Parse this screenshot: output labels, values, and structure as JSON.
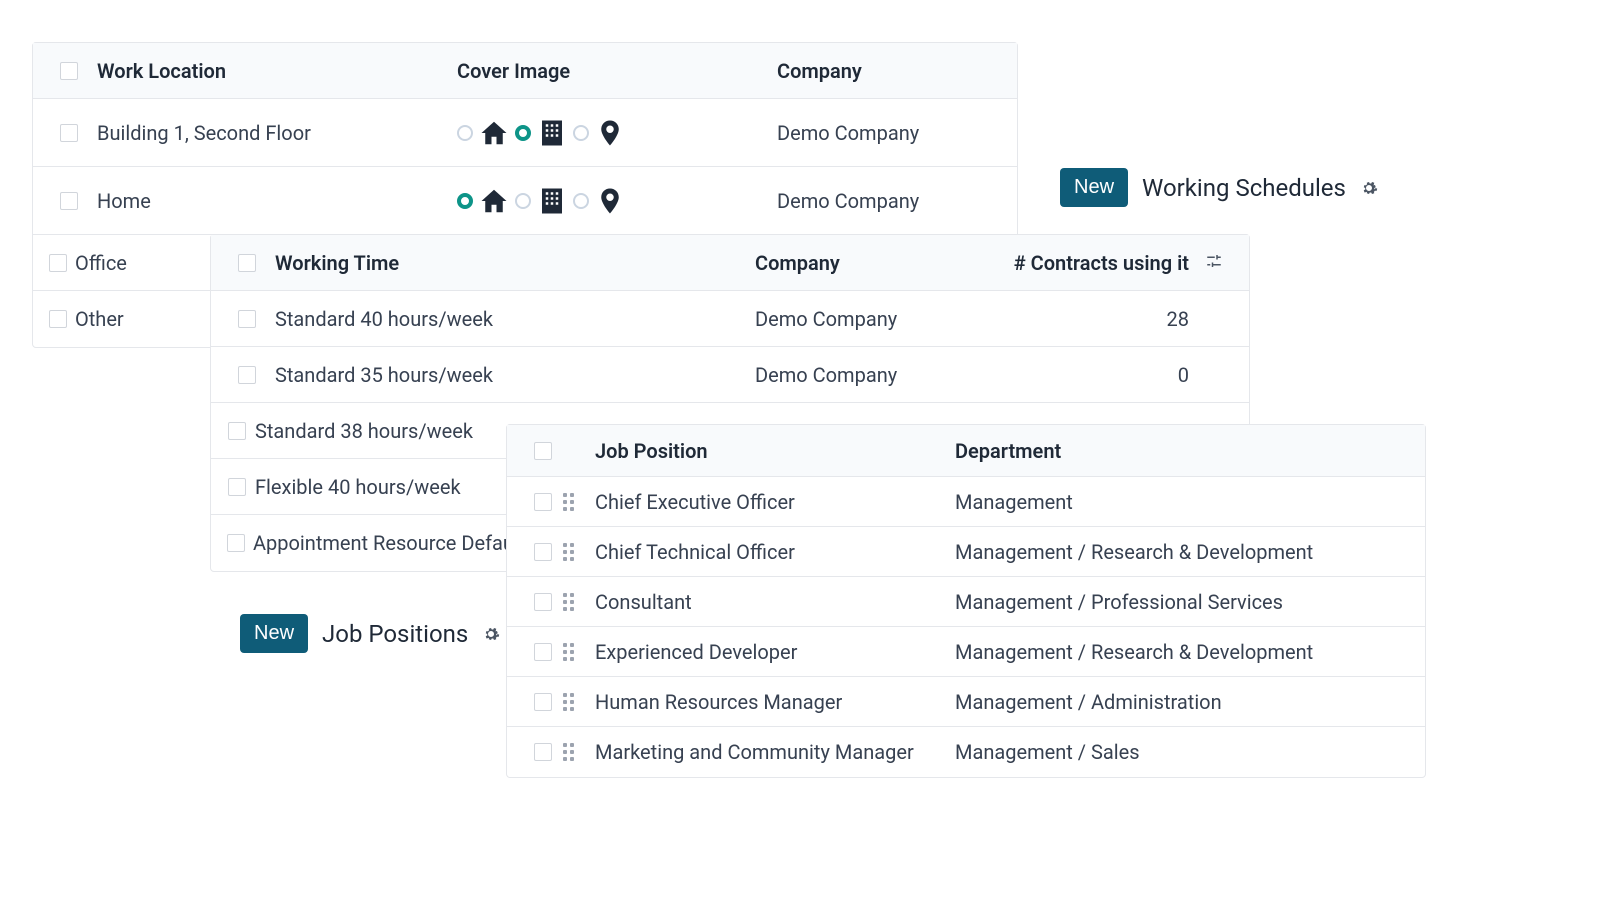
{
  "workLocations": {
    "headers": {
      "col1": "Work Location",
      "col2": "Cover Image",
      "col3": "Company"
    },
    "rows": [
      {
        "name": "Building 1, Second Floor",
        "company": "Demo Company",
        "selected": "building"
      },
      {
        "name": "Home",
        "company": "Demo Company",
        "selected": "home"
      },
      {
        "name": "Office",
        "company": "",
        "selected": ""
      },
      {
        "name": "Other",
        "company": "",
        "selected": ""
      }
    ]
  },
  "workingSchedules": {
    "buttonLabel": "New",
    "title": "Working Schedules"
  },
  "workingTimes": {
    "headers": {
      "col1": "Working Time",
      "col2": "Company",
      "col3": "# Contracts using it"
    },
    "rows": [
      {
        "name": "Standard 40 hours/week",
        "company": "Demo Company",
        "contracts": "28"
      },
      {
        "name": "Standard 35 hours/week",
        "company": "Demo Company",
        "contracts": "0"
      },
      {
        "name": "Standard 38 hours/week",
        "company": "",
        "contracts": ""
      },
      {
        "name": "Flexible 40 hours/week",
        "company": "",
        "contracts": ""
      },
      {
        "name": "Appointment Resource Default Calendar",
        "company": "",
        "contracts": ""
      }
    ]
  },
  "jobPositionsTitle": {
    "buttonLabel": "New",
    "title": "Job Positions"
  },
  "jobPositions": {
    "headers": {
      "col1": "Job Position",
      "col2": "Department"
    },
    "rows": [
      {
        "name": "Chief Executive Officer",
        "department": "Management"
      },
      {
        "name": "Chief Technical Officer",
        "department": "Management / Research & Development"
      },
      {
        "name": "Consultant",
        "department": "Management / Professional Services"
      },
      {
        "name": "Experienced Developer",
        "department": "Management / Research & Development"
      },
      {
        "name": "Human Resources Manager",
        "department": "Management / Administration"
      },
      {
        "name": "Marketing and Community Manager",
        "department": "Management / Sales"
      }
    ]
  }
}
